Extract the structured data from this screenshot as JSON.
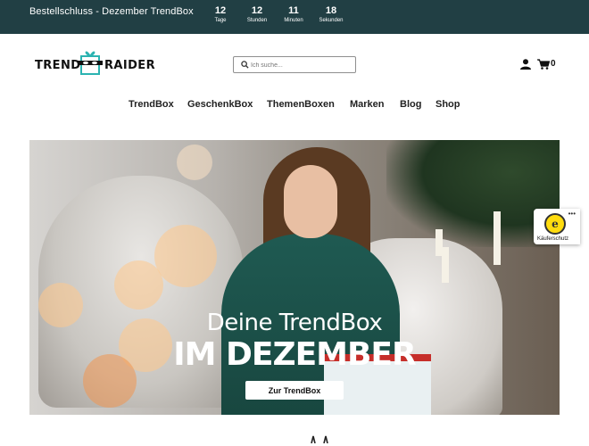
{
  "topbar": {
    "promo": "Bestellschluss - Dezember TrendBox",
    "countdown": [
      {
        "value": "12",
        "label": "Tage"
      },
      {
        "value": "12",
        "label": "Stunden"
      },
      {
        "value": "11",
        "label": "Minuten"
      },
      {
        "value": "18",
        "label": "Sekunden"
      }
    ]
  },
  "header": {
    "logo_left": "TREND",
    "logo_right": "RAIDER",
    "search_placeholder": "Ich suche...",
    "cart_count": "0"
  },
  "nav": {
    "items": [
      "TrendBox",
      "GeschenkBox",
      "ThemenBoxen",
      "Marken",
      "Blog",
      "Shop"
    ]
  },
  "hero": {
    "headline_top": "Deine TrendBox",
    "headline_bottom": "IM DEZEMBER",
    "cta": "Zur TrendBox"
  },
  "badge": {
    "seal_letter": "e",
    "text": "Käuferschutz"
  },
  "colors": {
    "topbar_bg": "#213f44",
    "logo_accent": "#2bb3b1",
    "hero_dress": "#1f5a52"
  }
}
